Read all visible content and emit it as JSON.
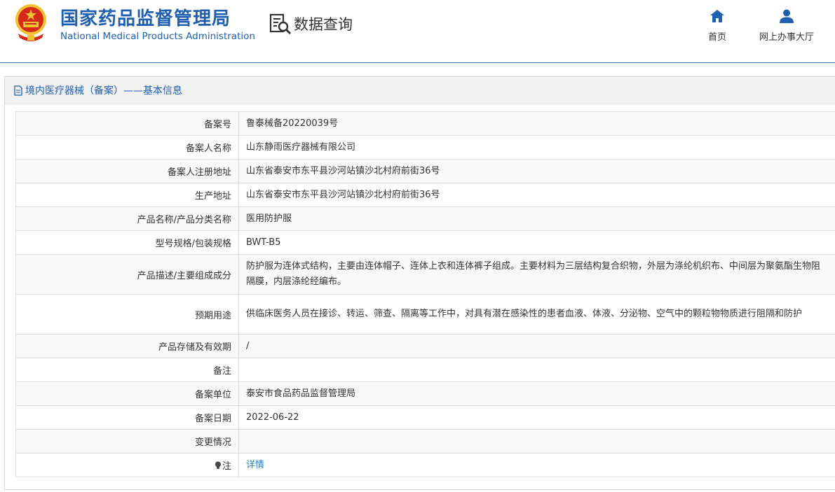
{
  "header": {
    "org_name_cn": "国家药品监督管理局",
    "org_name_en": "National Medical Products Administration",
    "query_title": "数据查询",
    "nav": {
      "home_label": "首页",
      "hall_label": "网上办事大厅"
    }
  },
  "panel": {
    "title": "境内医疗器械（备案）——基本信息"
  },
  "rows": [
    {
      "label": "备案号",
      "value": "鲁泰械备20220039号"
    },
    {
      "label": "备案人名称",
      "value": "山东静雨医疗器械有限公司"
    },
    {
      "label": "备案人注册地址",
      "value": "山东省泰安市东平县沙河站镇沙北村府前街36号"
    },
    {
      "label": "生产地址",
      "value": "山东省泰安市东平县沙河站镇沙北村府前街36号"
    },
    {
      "label": "产品名称/产品分类名称",
      "value": "医用防护服"
    },
    {
      "label": "型号规格/包装规格",
      "value": "BWT-B5"
    },
    {
      "label": "产品描述/主要组成成分",
      "value": "防护服为连体式结构，主要由连体帽子、连体上衣和连体裤子组成。主要材料为三层结构复合织物，外层为涤纶机织布、中间层为聚氨酯生物阻隔膜，内层涤纶经编布。"
    },
    {
      "label": "预期用途",
      "value": "供临床医务人员在接诊、转运、筛查、隔离等工作中，对具有潜在感染性的患者血液、体液、分泌物、空气中的颗粒物物质进行阻隔和防护"
    },
    {
      "label": "产品存储及有效期",
      "value": "/"
    },
    {
      "label": "备注",
      "value": ""
    },
    {
      "label": "备案单位",
      "value": "泰安市食品药品监督管理局"
    },
    {
      "label": "备案日期",
      "value": "2022-06-22"
    },
    {
      "label": "变更情况",
      "value": ""
    },
    {
      "label": "注",
      "value": "详情"
    }
  ],
  "icons": {
    "home": "home-icon",
    "user": "user-icon",
    "query": "search-document-icon",
    "doc": "document-icon",
    "note": "lightbulb-icon"
  },
  "colors": {
    "brand": "#1f5fb0",
    "link": "#1f7fd0",
    "emblem_red": "#d7281c",
    "emblem_gold": "#f1c232"
  }
}
